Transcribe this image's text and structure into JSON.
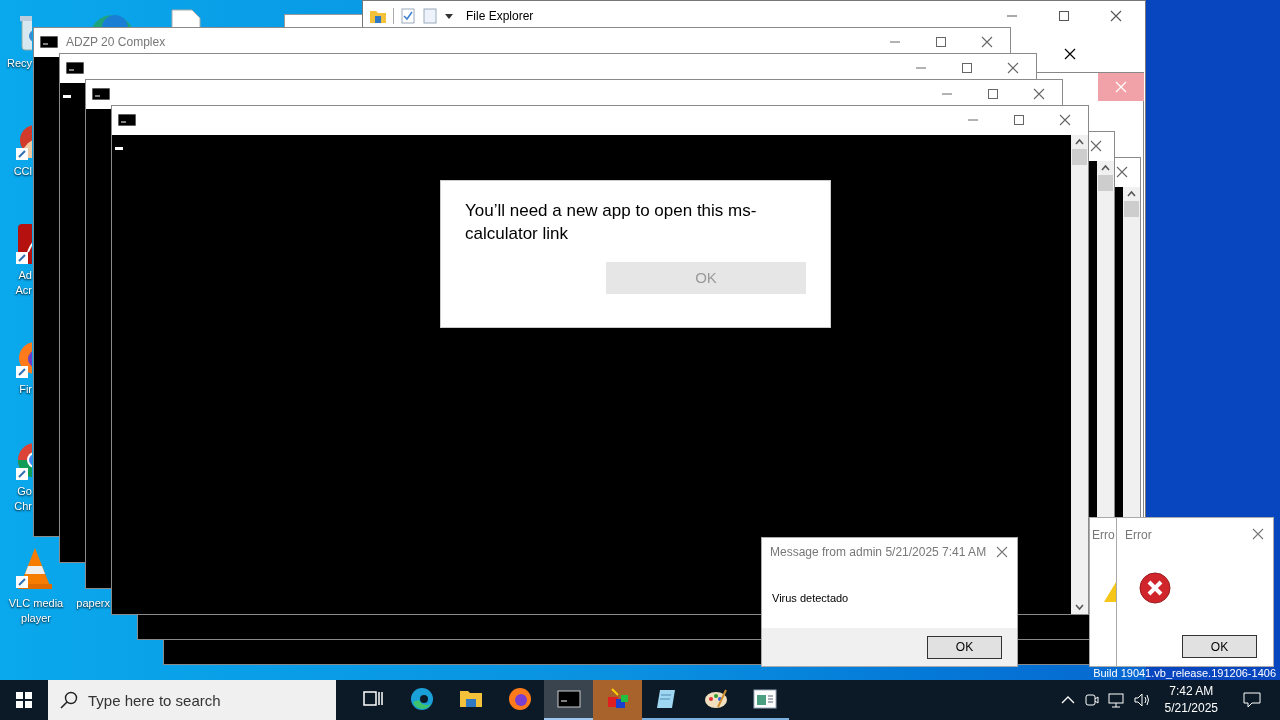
{
  "desktop_icons": [
    {
      "lines": [
        "Recy"
      ]
    },
    {
      "lines": [
        "CCl"
      ]
    },
    {
      "lines": [
        "Ad",
        "Acr"
      ]
    },
    {
      "lines": [
        "Fir"
      ]
    },
    {
      "lines": [
        "Go",
        "Chr"
      ]
    },
    {
      "lines": [
        "VLC media",
        "player"
      ]
    },
    {
      "lines": [
        "paperx"
      ]
    }
  ],
  "explorer": {
    "title": "File Explorer"
  },
  "console_window": {
    "title": "ADZP 20 Complex"
  },
  "app_prompt": {
    "message": "You’ll need a new app to open this ms-calculator link",
    "button": "OK",
    "button_disabled": true
  },
  "message_box": {
    "title": "Message from admin 5/21/2025 7:41 AM",
    "text": "Virus detectado",
    "button": "OK"
  },
  "error_windows": [
    {
      "title": "Erro"
    },
    {
      "title": "Error",
      "button": "OK"
    }
  ],
  "build_text": "Build 19041.vb_release.191206-1406",
  "taskbar": {
    "search_placeholder": "Type here to search",
    "apps": [
      {
        "kind": "edge",
        "selected": false,
        "running": false,
        "attention": false
      },
      {
        "kind": "folder",
        "selected": false,
        "running": false,
        "attention": false
      },
      {
        "kind": "firefox",
        "selected": false,
        "running": false,
        "attention": false
      },
      {
        "kind": "console",
        "selected": true,
        "running": true,
        "attention": false
      },
      {
        "kind": "cubes",
        "selected": false,
        "running": false,
        "attention": true
      },
      {
        "kind": "notepad",
        "selected": false,
        "running": true,
        "attention": false
      },
      {
        "kind": "paint",
        "selected": false,
        "running": true,
        "attention": false
      },
      {
        "kind": "window",
        "selected": false,
        "running": true,
        "attention": false
      }
    ],
    "time": "7:42 AM",
    "date": "5/21/2025"
  }
}
